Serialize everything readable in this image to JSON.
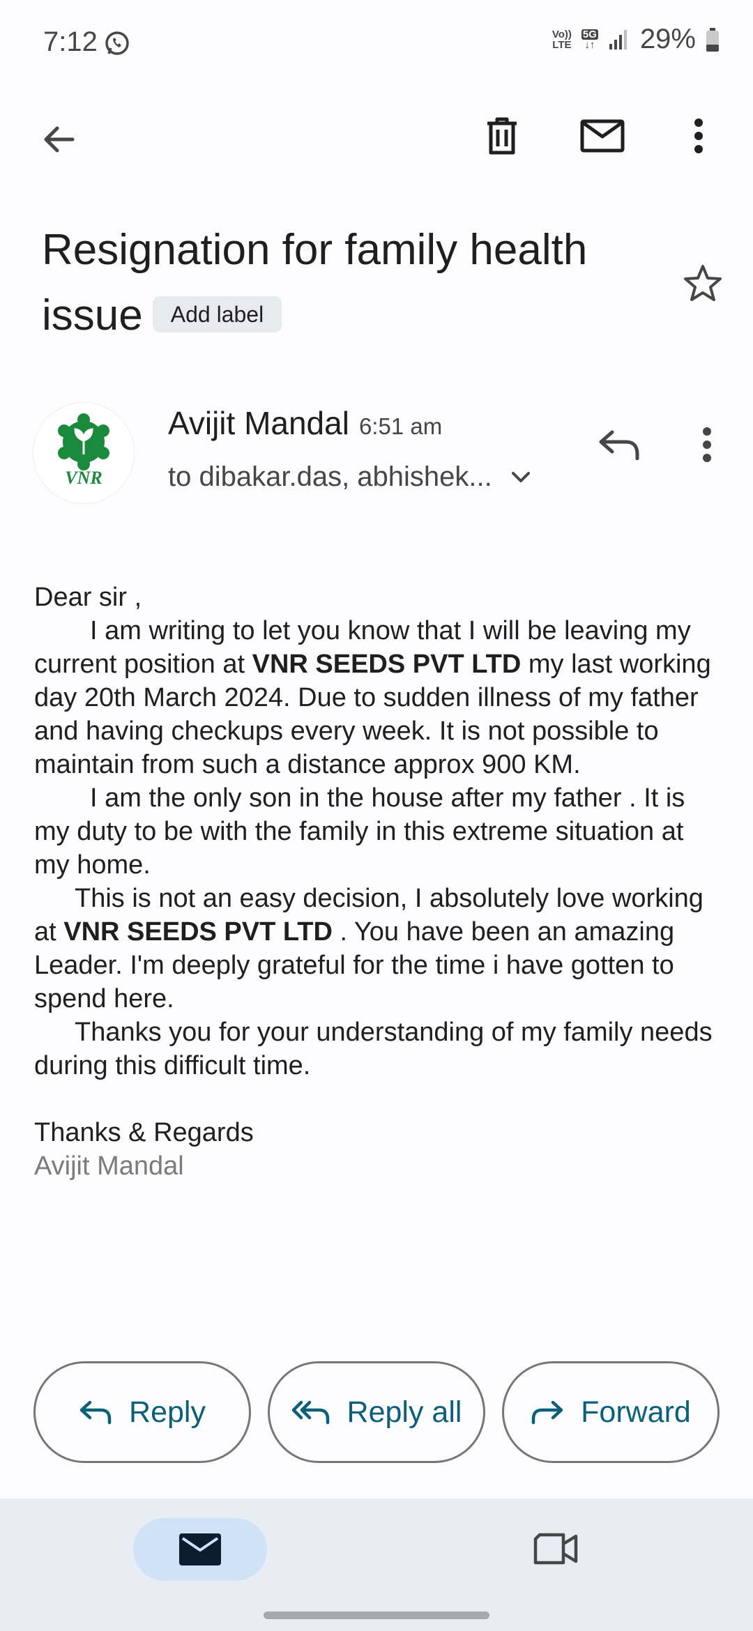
{
  "status": {
    "time": "7:12",
    "battery": "29%",
    "volte_top": "Vo))",
    "volte_bottom": "LTE",
    "network": "5G"
  },
  "toolbar": {
    "back_icon": "arrow-left-icon",
    "delete_icon": "trash-icon",
    "mark_unread_icon": "envelope-icon",
    "more_icon": "more-vert-icon"
  },
  "email": {
    "subject": "Resignation for family health issue",
    "label_chip": "Add label",
    "sender": "Avijit Mandal",
    "time": "6:51 am",
    "recipients": "to dibakar.das, abhishek...",
    "avatar_text": "VNR",
    "body": {
      "greeting": "Dear sir ,",
      "p1_a": "I am writing to let you know that I will be leaving my current position at ",
      "company": "VNR SEEDS PVT LTD",
      "p1_b": " my last working day 20th March 2024. Due to sudden illness of my father and having checkups every week. It is not possible to maintain from such a distance approx 900 KM.",
      "p2": "I am the only son in the house after my father . It is my duty to be with the family in this extreme situation at my home.",
      "p3_a": "This is not an easy decision, I absolutely love working at ",
      "p3_b": " . You have been an amazing Leader. I'm deeply grateful for the time i have gotten to spend here.",
      "p4": "Thanks you for your understanding of my family needs during this difficult time.",
      "closing": "Thanks & Regards",
      "signature": "Avijit Mandal"
    }
  },
  "actions": {
    "reply": "Reply",
    "reply_all": "Reply all",
    "forward": "Forward"
  },
  "colors": {
    "accent": "#0b5f79",
    "nav_bg": "#e8edf4",
    "nav_active": "#cfe2f6",
    "logo_green": "#1a8a3c"
  }
}
